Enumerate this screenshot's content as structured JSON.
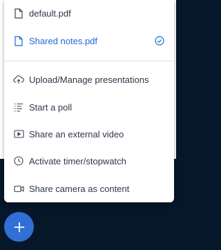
{
  "presentations": [
    {
      "label": "default.pdf",
      "icon": "document-icon",
      "selected": false
    },
    {
      "label": "Shared notes.pdf",
      "icon": "document-icon",
      "selected": true
    }
  ],
  "actions": [
    {
      "label": "Upload/Manage presentations",
      "icon": "cloud-upload-icon"
    },
    {
      "label": "Start a poll",
      "icon": "poll-list-icon"
    },
    {
      "label": "Share an external video",
      "icon": "video-screen-icon"
    },
    {
      "label": "Activate timer/stopwatch",
      "icon": "clock-icon"
    },
    {
      "label": "Share camera as content",
      "icon": "camera-icon"
    }
  ],
  "fab": {
    "icon": "plus-icon"
  },
  "colors": {
    "accent": "#1b6bd1",
    "fab": "#2f6fd6",
    "background_dark": "#06172a"
  }
}
